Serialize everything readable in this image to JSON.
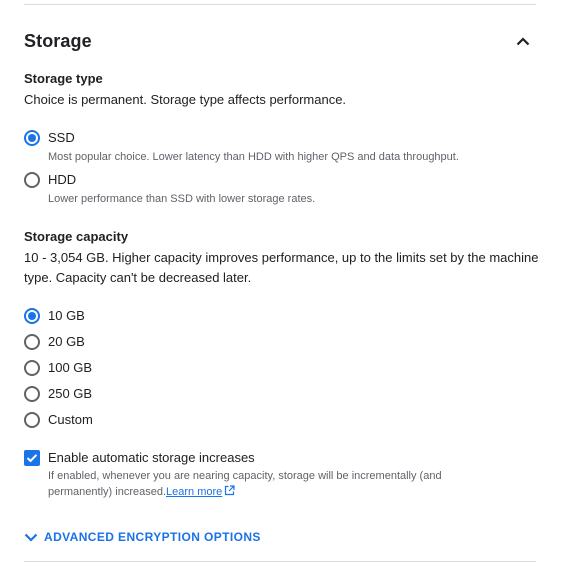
{
  "section": {
    "title": "Storage",
    "collapse_icon": "chevron-up-icon"
  },
  "storage_type": {
    "title": "Storage type",
    "description": "Choice is permanent. Storage type affects performance.",
    "options": [
      {
        "label": "SSD",
        "sub": "Most popular choice. Lower latency than HDD with higher QPS and data throughput.",
        "selected": true
      },
      {
        "label": "HDD",
        "sub": "Lower performance than SSD with lower storage rates.",
        "selected": false
      }
    ]
  },
  "storage_capacity": {
    "title": "Storage capacity",
    "description_line1": "10 - 3,054 GB. Higher capacity improves performance, up to the limits set by the machine",
    "description_line2": "type. Capacity can't be decreased later.",
    "options": [
      {
        "label": "10 GB",
        "selected": true
      },
      {
        "label": "20 GB",
        "selected": false
      },
      {
        "label": "100 GB",
        "selected": false
      },
      {
        "label": "250 GB",
        "selected": false
      },
      {
        "label": "Custom",
        "selected": false
      }
    ]
  },
  "auto_increase": {
    "label": "Enable automatic storage increases",
    "checked": true,
    "sub": "If enabled, whenever you are nearing capacity, storage will be incrementally (and permanently) increased.",
    "learn_more": "Learn more",
    "link_icon": "open-in-new-icon"
  },
  "advanced": {
    "label": "ADVANCED ENCRYPTION OPTIONS",
    "icon": "chevron-down-icon"
  },
  "colors": {
    "accent": "#1a73e8",
    "text": "#202124",
    "secondary_text": "#5f6368",
    "divider": "#dadce0"
  }
}
